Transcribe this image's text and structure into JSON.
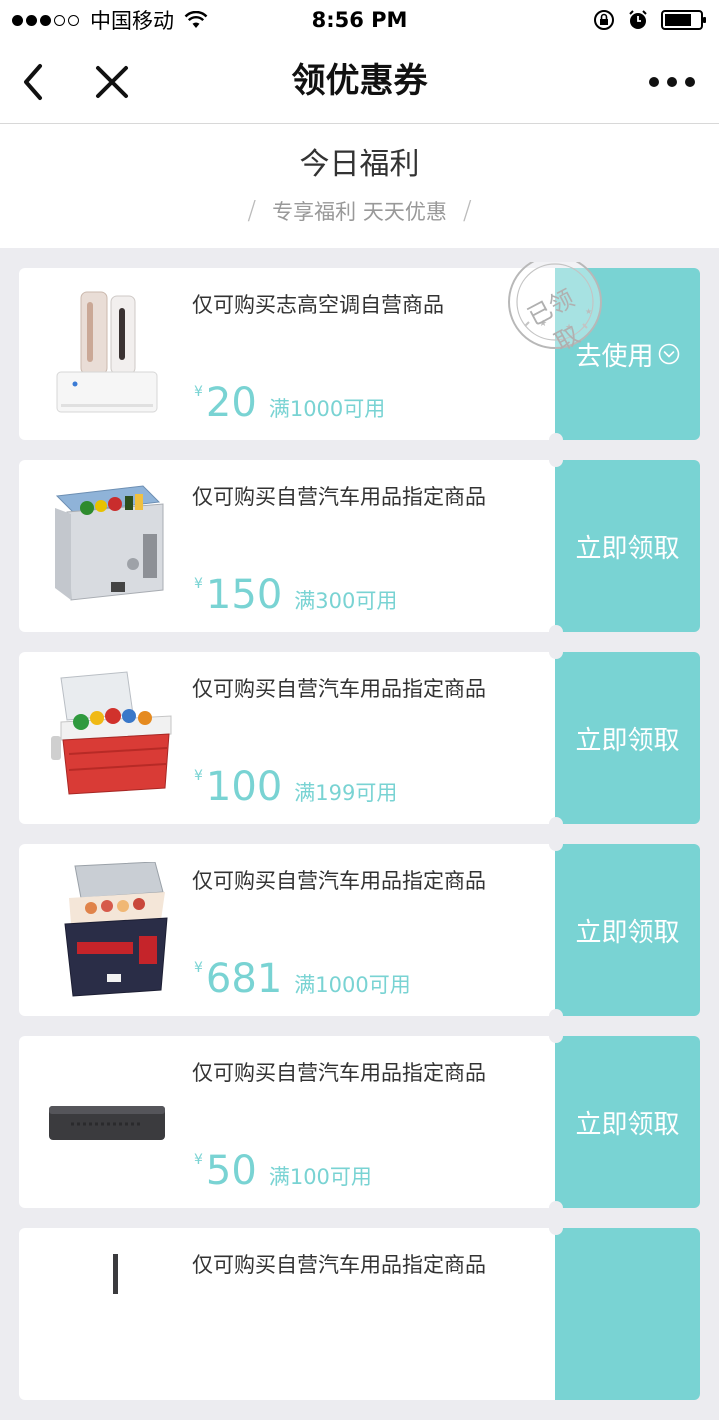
{
  "status_bar": {
    "carrier": "中国移动",
    "time": "8:56 PM"
  },
  "nav": {
    "title": "领优惠券"
  },
  "section": {
    "title": "今日福利",
    "subtitle": "专享福利 天天优惠"
  },
  "coupons": [
    {
      "desc": "仅可购买志高空调自营商品",
      "currency": "¥",
      "amount": "20",
      "condition": "满1000可用",
      "button": "去使用",
      "claimed": true,
      "stamp_text": "已领取",
      "product": "air-conditioner"
    },
    {
      "desc": "仅可购买自营汽车用品指定商品",
      "currency": "¥",
      "amount": "150",
      "condition": "满300可用",
      "button": "立即领取",
      "claimed": false,
      "product": "car-fridge-grey"
    },
    {
      "desc": "仅可购买自营汽车用品指定商品",
      "currency": "¥",
      "amount": "100",
      "condition": "满199可用",
      "button": "立即领取",
      "claimed": false,
      "product": "red-cooler"
    },
    {
      "desc": "仅可购买自营汽车用品指定商品",
      "currency": "¥",
      "amount": "681",
      "condition": "满1000可用",
      "button": "立即领取",
      "claimed": false,
      "product": "car-fridge-dark"
    },
    {
      "desc": "仅可购买自营汽车用品指定商品",
      "currency": "¥",
      "amount": "50",
      "condition": "满100可用",
      "button": "立即领取",
      "claimed": false,
      "product": "black-box"
    },
    {
      "desc": "仅可购买自营汽车用品指定商品",
      "currency": "¥",
      "amount": "",
      "condition": "",
      "button": "",
      "claimed": false,
      "product": "partial"
    }
  ],
  "colors": {
    "accent": "#79d3d3",
    "background": "#ececf0"
  }
}
